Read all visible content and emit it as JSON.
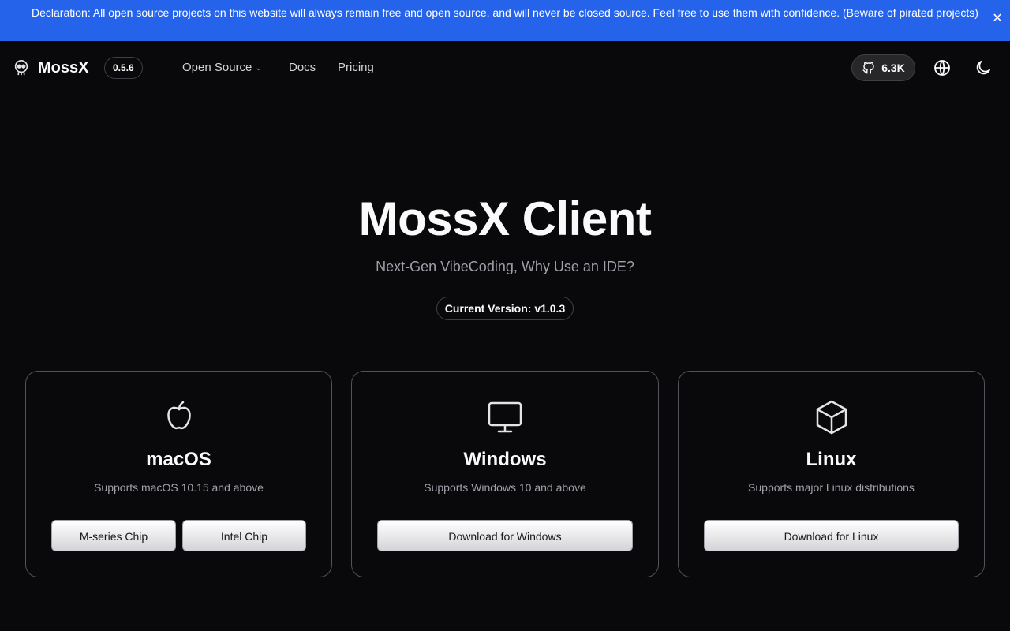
{
  "banner": {
    "text": "Declaration: All open source projects on this website will always remain free and open source, and will never be closed source. Feel free to use them with confidence. (Beware of pirated projects)",
    "close_icon": "close-icon",
    "background": "#2563eb"
  },
  "nav": {
    "brand": "MossX",
    "version": "0.5.6",
    "links": [
      {
        "label": "Open Source",
        "has_dropdown": true
      },
      {
        "label": "Docs"
      },
      {
        "label": "Pricing"
      }
    ],
    "github_stars": "6.3K",
    "icons": [
      "github-icon",
      "globe-icon",
      "moon-icon"
    ]
  },
  "hero": {
    "title": "MossX Client",
    "subtitle": "Next-Gen VibeCoding, Why Use an IDE?",
    "current_version": "Current Version: v1.0.3"
  },
  "platforms": [
    {
      "icon": "apple-icon",
      "name": "macOS",
      "desc": "Supports macOS 10.15 and above",
      "buttons": [
        "M-series Chip",
        "Intel Chip"
      ]
    },
    {
      "icon": "monitor-icon",
      "name": "Windows",
      "desc": "Supports Windows 10 and above",
      "buttons": [
        "Download for Windows"
      ]
    },
    {
      "icon": "box-icon",
      "name": "Linux",
      "desc": "Supports major Linux distributions",
      "buttons": [
        "Download for Linux"
      ]
    }
  ]
}
